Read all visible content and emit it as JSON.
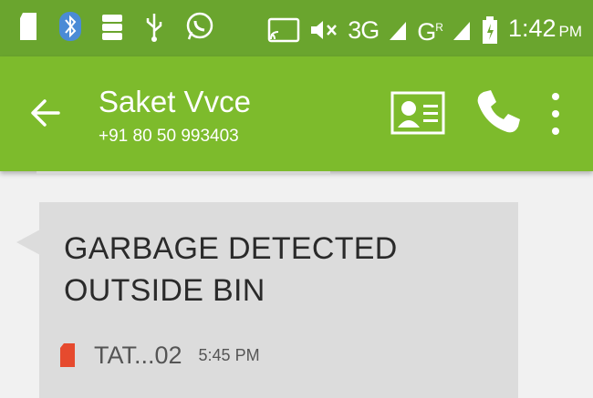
{
  "status_bar": {
    "icons_left": [
      "sd-card-icon",
      "bluetooth-icon",
      "storage-icon",
      "usb-icon",
      "whatsapp-icon"
    ],
    "icons_right": [
      "cast-icon",
      "mute-icon",
      "signal-icon",
      "battery-icon"
    ],
    "network_3g": "3G",
    "network_g": "G",
    "roaming": "R",
    "time": "1:42",
    "ampm": "PM"
  },
  "toolbar": {
    "contact_name": "Saket Vvce",
    "contact_number": "+91 80 50 993403"
  },
  "message": {
    "text": "GARBAGE DETECTED OUTSIDE BIN",
    "sim_label": "TAT...02",
    "time": "5:45 PM"
  },
  "colors": {
    "status_bar": "#6aa52e",
    "toolbar": "#7dbb2c",
    "bubble": "#dcdcdc",
    "sim_icon": "#e64a2e",
    "bluetooth": "#4a8bd6"
  }
}
